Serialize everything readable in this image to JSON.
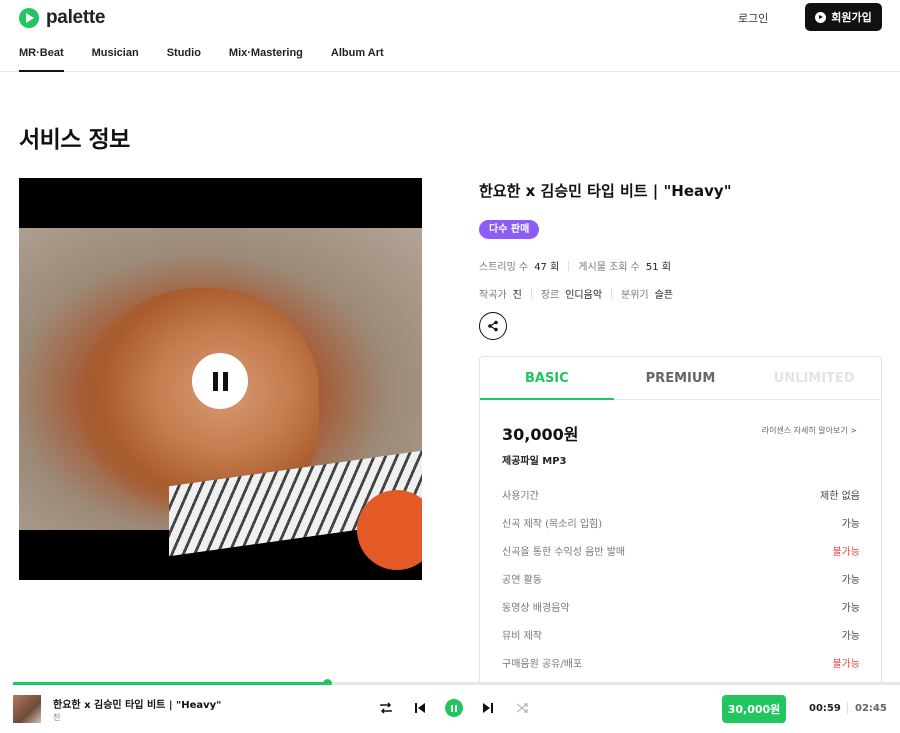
{
  "header": {
    "logo_text": "palette",
    "login": "로그인",
    "signup": "회원가입"
  },
  "nav": [
    {
      "label": "MR·Beat",
      "active": true
    },
    {
      "label": "Musician"
    },
    {
      "label": "Studio"
    },
    {
      "label": "Mix·Mastering"
    },
    {
      "label": "Album Art"
    }
  ],
  "page_title": "서비스 정보",
  "track": {
    "title": "한요한 x 김승민 타입 비트 | \"Heavy\"",
    "badge": "다수 판매",
    "stats": {
      "streams_label": "스트리밍 수",
      "streams_value": "47 회",
      "views_label": "게시물 조회 수",
      "views_value": "51 회"
    },
    "info": {
      "composer_label": "작곡가",
      "composer_value": "진",
      "genre_label": "장르",
      "genre_value": "인디음악",
      "mood_label": "분위기",
      "mood_value": "슬픈"
    }
  },
  "license": {
    "tabs": [
      {
        "label": "BASIC",
        "state": "active"
      },
      {
        "label": "PREMIUM",
        "state": "normal"
      },
      {
        "label": "UNLIMITED",
        "state": "disabled"
      }
    ],
    "price": "30,000원",
    "detail_link": "라이센스 자세히 알아보기 >",
    "file_type": "제공파일 MP3",
    "rights": [
      {
        "label": "사용기간",
        "value": "제한 없음",
        "status": "ok"
      },
      {
        "label": "신곡 제작 (목소리 입힘)",
        "value": "가능",
        "status": "ok"
      },
      {
        "label": "신곡을 통한 수익성 음반 발매",
        "value": "불가능",
        "status": "no"
      },
      {
        "label": "공연 활동",
        "value": "가능",
        "status": "ok"
      },
      {
        "label": "동영상 배경음악",
        "value": "가능",
        "status": "ok"
      },
      {
        "label": "뮤비 제작",
        "value": "가능",
        "status": "ok"
      },
      {
        "label": "구매음원 공유/배포",
        "value": "불가능",
        "status": "no"
      }
    ]
  },
  "player": {
    "title": "한요한 x 김승민 타입 비트 | \"Heavy\"",
    "artist": "진",
    "buy_label": "30,000원",
    "current_time": "00:59",
    "total_time": "02:45",
    "progress": 0.354
  },
  "colors": {
    "accent": "#22c55e",
    "badge": "#8b5cf6",
    "negative": "#ef4444"
  }
}
